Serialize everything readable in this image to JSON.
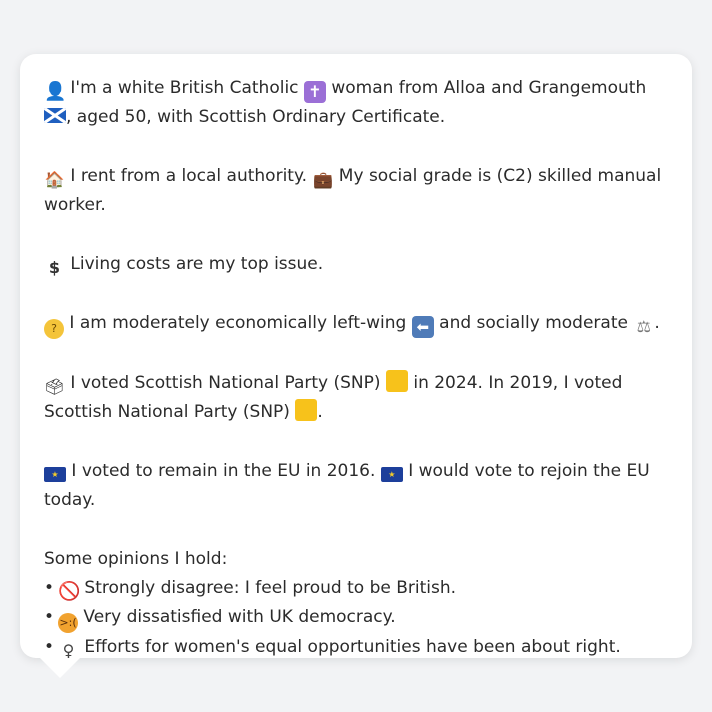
{
  "paragraphs": [
    {
      "p1_icon": "bust-in-silhouette-icon",
      "p1_a": " I'm a white British Catholic ",
      "p1_icon2": "latin-cross-icon",
      "p1_b": " woman from Alloa and Grangemouth ",
      "p1_icon3": "scotland-flag-icon",
      "p1_c": ", aged 50, with Scottish Ordinary Certificate."
    }
  ],
  "intro": {
    "text_a": " I'm a white British Catholic ",
    "text_b": " woman from Alloa and Grangemouth ",
    "text_c": ", aged 50, with Scottish Ordinary Certificate."
  },
  "housing": {
    "text_a": " I rent from a local authority. ",
    "text_b": " My social grade is (C2) skilled manual worker."
  },
  "issue": {
    "text": " Living costs are my top issue."
  },
  "ideology": {
    "text_a": " I am moderately economically left-wing ",
    "text_b": " and socially moderate ",
    "text_c": "."
  },
  "votes": {
    "text_a": " I voted Scottish National Party (SNP) ",
    "text_b": " in 2024. In 2019, I voted Scottish National Party (SNP) ",
    "text_c": "."
  },
  "eu": {
    "text_a": " I voted to remain in the EU in 2016. ",
    "text_b": " I would vote to rejoin the EU today."
  },
  "opinions": {
    "title": "Some opinions I hold:",
    "bullet": "•",
    "items": [
      {
        "text": " Strongly disagree: I feel proud to be British."
      },
      {
        "text": " Very dissatisfied with UK democracy."
      },
      {
        "text": " Efforts for women's equal opportunities have been about right."
      }
    ]
  },
  "colors": {
    "background": "#f2f3f5",
    "card": "#ffffff",
    "text": "#2b2b2b",
    "snp_yellow": "#f7c21b",
    "eu_blue": "#1d3f9b",
    "scotland_blue": "#1f5fbf"
  },
  "icons": {
    "person": "👤",
    "cross": "✝",
    "house": "🏠",
    "briefcase": "💼",
    "dollar": "$",
    "thinking": "🤔",
    "arrow_left": "⬅",
    "scales": "⚖",
    "ballot": "🗳",
    "eu_stars": "★",
    "prohibited": "🚫",
    "angry": "😠",
    "female": "♀"
  }
}
